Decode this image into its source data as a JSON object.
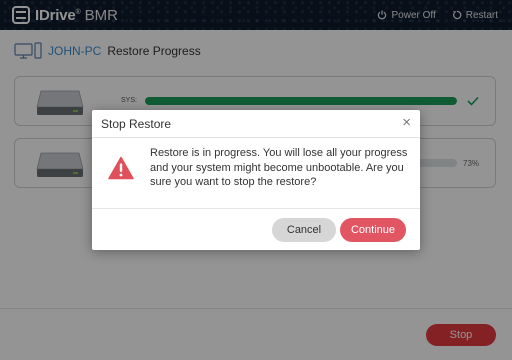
{
  "app": {
    "logo_text": "IDrive",
    "logo_reg": "®",
    "logo_sub": "BMR",
    "power_off_label": "Power Off",
    "restart_label": "Restart"
  },
  "page": {
    "pc_name": "JOHN-PC",
    "title": "Restore Progress"
  },
  "disks": [
    {
      "label": "SYS:",
      "progress_percent": 100,
      "status": "complete"
    },
    {
      "label": "",
      "percent_text": "73%",
      "progress_percent": 73,
      "status": "in-progress"
    }
  ],
  "footer": {
    "stop_label": "Stop"
  },
  "dialog": {
    "title": "Stop Restore",
    "close_symbol": "×",
    "message": "Restore is in progress. You will lose all your progress and your system might become unbootable. Are you sure you want to stop the restore?",
    "cancel_label": "Cancel",
    "continue_label": "Continue"
  },
  "colors": {
    "progress_complete": "#1a9f5a",
    "progress_track": "#dfe3e6",
    "stop_button": "#e43a3f",
    "continue_button": "#e25663",
    "cancel_button": "#d6d6d6",
    "warning": "#e0505a",
    "pc_name": "#3b8ed0"
  },
  "icons": [
    "logo-icon",
    "power-icon",
    "restart-icon",
    "computer-icon",
    "disk-drive-icon",
    "checkmark-icon",
    "warning-icon",
    "close-icon"
  ]
}
